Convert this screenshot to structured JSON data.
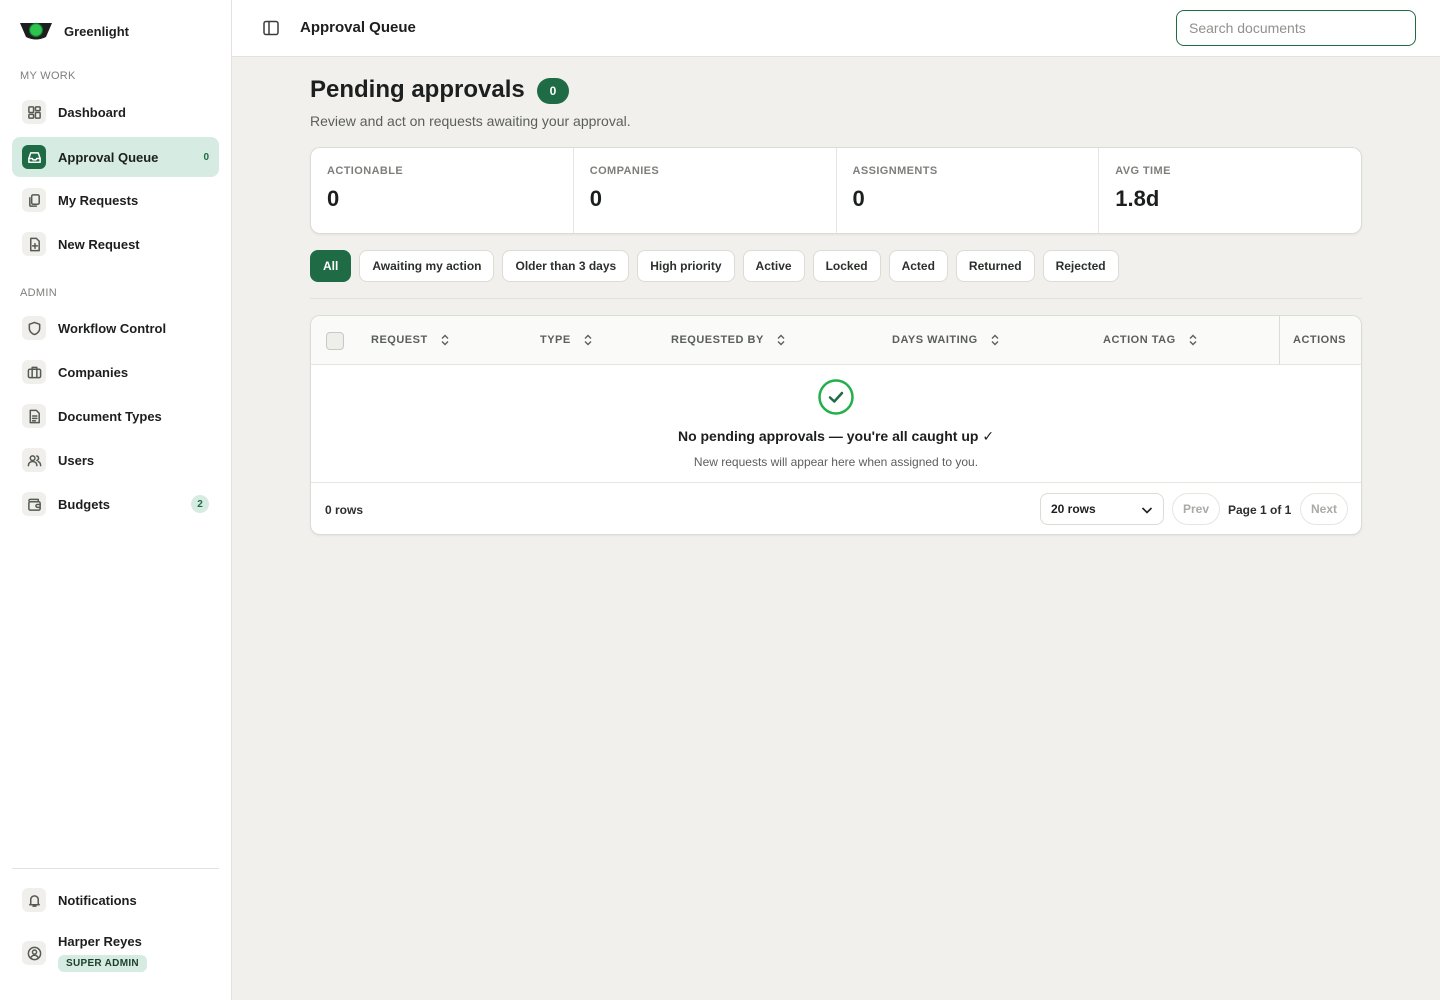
{
  "app": {
    "name": "Greenlight"
  },
  "sidebar": {
    "section_my_work": "MY WORK",
    "section_admin": "ADMIN",
    "items": [
      {
        "label": "Dashboard",
        "icon": "dashboard-icon"
      },
      {
        "label": "Approval Queue",
        "icon": "inbox-icon",
        "count": "0",
        "active": true
      },
      {
        "label": "My Requests",
        "icon": "copy-icon"
      },
      {
        "label": "New Request",
        "icon": "file-plus-icon"
      },
      {
        "label": "Workflow Control",
        "icon": "shield-icon"
      },
      {
        "label": "Companies",
        "icon": "briefcase-icon"
      },
      {
        "label": "Document Types",
        "icon": "document-icon"
      },
      {
        "label": "Users",
        "icon": "users-icon"
      },
      {
        "label": "Budgets",
        "icon": "wallet-icon",
        "count": "2"
      }
    ],
    "notifications": "Notifications",
    "user": {
      "name": "Harper Reyes",
      "role": "SUPER ADMIN"
    }
  },
  "topbar": {
    "title": "Approval Queue",
    "search_placeholder": "Search documents"
  },
  "main": {
    "title": "Pending approvals",
    "title_count": "0",
    "subtitle": "Review and act on requests awaiting your approval.",
    "stats": [
      {
        "label": "ACTIONABLE",
        "value": "0"
      },
      {
        "label": "COMPANIES",
        "value": "0"
      },
      {
        "label": "ASSIGNMENTS",
        "value": "0"
      },
      {
        "label": "AVG TIME",
        "value": "1.8d"
      }
    ],
    "filters": [
      "All",
      "Awaiting my action",
      "Older than 3 days",
      "High priority",
      "Active",
      "Locked",
      "Acted",
      "Returned",
      "Rejected"
    ],
    "active_filter": "All",
    "table": {
      "columns": [
        "REQUEST",
        "TYPE",
        "REQUESTED BY",
        "DAYS WAITING",
        "ACTION TAG",
        "ACTIONS"
      ],
      "empty_title": "No pending approvals — you're all caught up ✓",
      "empty_subtitle": "New requests will appear here when assigned to you.",
      "row_count": "0 rows",
      "rows_per_page": "20 rows",
      "prev": "Prev",
      "page_info": "Page 1 of 1",
      "next": "Next"
    }
  },
  "colors": {
    "accent": "#1f6b45",
    "accent_light": "#d6ebe1",
    "success": "#22b04b",
    "background": "#f1f0ec"
  }
}
